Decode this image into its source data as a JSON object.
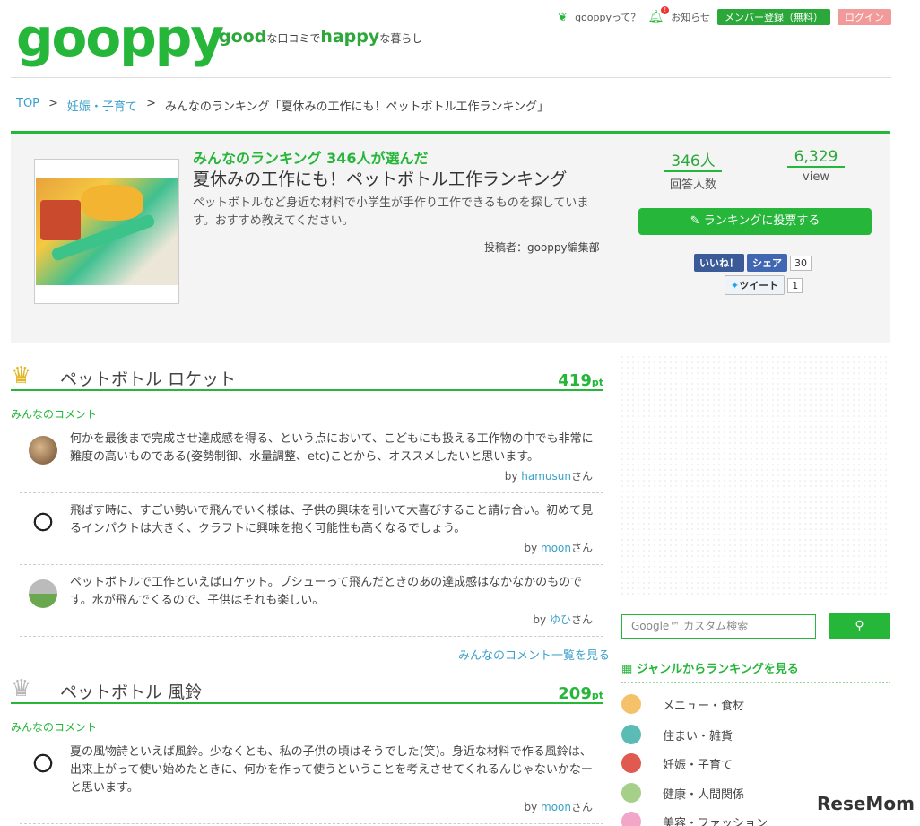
{
  "header": {
    "logo": "gooppy",
    "tagline_good": "good",
    "tagline_mid": "な口コミで",
    "tagline_happy": "happy",
    "tagline_end": "な暮らし",
    "nav_about": "gooppyって？",
    "nav_notice": "お知らせ",
    "nav_member": "メンバー登録（無料）",
    "nav_login": "ログイン"
  },
  "breadcrumb": {
    "top": "TOP",
    "category": "妊娠・子育て",
    "current": "みんなのランキング「夏休みの工作にも！ペットボトル工作ランキング」",
    "sep": ">"
  },
  "ranking": {
    "kicker": "みんなのランキング 346人が選んだ",
    "title": "夏休みの工作にも！ペットボトル工作ランキング",
    "description": "ペットボトルなど身近な材料で小学生が手作り工作できるものを探しています。おすすめ教えてください。",
    "author": "投稿者：gooppy編集部",
    "respondents": "346人",
    "respondents_label": "回答人数",
    "views": "6,329",
    "views_label": "view",
    "vote_button": "ランキングに投票する",
    "fb_like": "いいね！",
    "fb_share": "シェア",
    "fb_count": "30",
    "tweet": "ツイート",
    "tweet_count": "1"
  },
  "items": [
    {
      "name": "ペットボトル ロケット",
      "points": "419",
      "points_unit": "pt",
      "comments_label": "みんなのコメント",
      "comments": [
        {
          "text": "何かを最後まで完成させ達成感を得る、という点において、こどもにも扱える工作物の中でも非常に難度の高いものである(姿勢制御、水量調整、etc)ことから、オススメしたいと思います。",
          "by_prefix": "by",
          "user": "hamusun",
          "suffix": "さん"
        },
        {
          "text": "飛ばす時に、すごい勢いで飛んでいく様は、子供の興味を引いて大喜びすること請け合い。初めて見るインパクトは大きく、クラフトに興味を抱く可能性も高くなるでしょう。",
          "by_prefix": "by",
          "user": "moon",
          "suffix": "さん"
        },
        {
          "text": "ペットボトルで工作といえばロケット。プシューって飛んだときのあの達成感はなかなかのものです。水が飛んでくるので、子供はそれも楽しい。",
          "by_prefix": "by",
          "user": "ゆひ",
          "suffix": "さん"
        }
      ],
      "more": "みんなのコメント一覧を見る"
    },
    {
      "name": "ペットボトル 風鈴",
      "points": "209",
      "points_unit": "pt",
      "comments_label": "みんなのコメント",
      "comments": [
        {
          "text": "夏の風物詩といえば風鈴。少なくとも、私の子供の頃はそうでした(笑)。身近な材料で作る風鈴は、出来上がって使い始めたときに、何かを作って使うということを考えさせてくれるんじゃないかなーと思います。",
          "by_prefix": "by",
          "user": "moon",
          "suffix": "さん"
        }
      ]
    }
  ],
  "sidebar": {
    "search_placeholder": "Google™ カスタム検索",
    "genre_heading": "ジャンルからランキングを見る",
    "genres": [
      "メニュー・食材",
      "住まい・雑貨",
      "妊娠・子育て",
      "健康・人間関係",
      "美容・ファッション"
    ]
  },
  "watermark": "ReseMom",
  "colors": {
    "brand": "#25b63a",
    "link": "#3aa0c8",
    "login": "#f29a9a"
  }
}
